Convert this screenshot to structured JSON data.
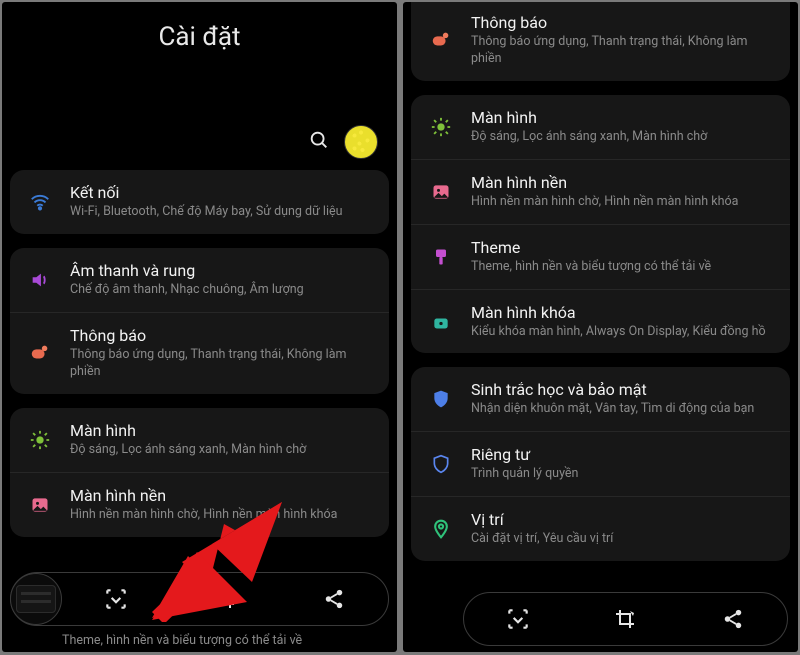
{
  "left": {
    "header_title": "Cài đặt",
    "peek_text": "Theme, hình nền và biểu tượng có thể tải về",
    "sections": [
      {
        "items": [
          {
            "icon": "wifi-icon",
            "color": "c-wifi",
            "title": "Kết nối",
            "sub": "Wi-Fi, Bluetooth, Chế độ Máy bay, Sử dụng dữ liệu"
          }
        ]
      },
      {
        "items": [
          {
            "icon": "sound-icon",
            "color": "c-sound",
            "title": "Âm thanh và rung",
            "sub": "Chế độ âm thanh, Nhạc chuông, Âm lượng"
          },
          {
            "icon": "bell-icon",
            "color": "c-notif",
            "title": "Thông báo",
            "sub": "Thông báo ứng dụng, Thanh trạng thái, Không làm phiền"
          }
        ]
      },
      {
        "items": [
          {
            "icon": "sun-icon",
            "color": "c-disp",
            "title": "Màn hình",
            "sub": "Độ sáng, Lọc ánh sáng xanh, Màn hình chờ"
          },
          {
            "icon": "image-icon",
            "color": "c-wall",
            "title": "Màn hình nền",
            "sub": "Hình nền màn hình chờ, Hình nền màn hình khóa"
          }
        ]
      }
    ]
  },
  "right": {
    "sections": [
      {
        "partial_top": true,
        "items": [
          {
            "icon": "bell-icon",
            "color": "c-notif",
            "title": "Thông báo",
            "sub": "Thông báo ứng dụng, Thanh trạng thái, Không làm phiền"
          }
        ]
      },
      {
        "items": [
          {
            "icon": "sun-icon",
            "color": "c-disp",
            "title": "Màn hình",
            "sub": "Độ sáng, Lọc ánh sáng xanh, Màn hình chờ"
          },
          {
            "icon": "image-icon",
            "color": "c-wall",
            "title": "Màn hình nền",
            "sub": "Hình nền màn hình chờ, Hình nền màn hình khóa"
          },
          {
            "icon": "brush-icon",
            "color": "c-theme",
            "title": "Theme",
            "sub": "Theme, hình nền và biểu tượng có thể tải về"
          },
          {
            "icon": "lock-icon",
            "color": "c-lock",
            "title": "Màn hình khóa",
            "sub": "Kiểu khóa màn hình, Always On Display, Kiểu đồng hồ"
          }
        ]
      },
      {
        "items": [
          {
            "icon": "shield-icon",
            "color": "c-bio",
            "title": "Sinh trắc học và bảo mật",
            "sub": "Nhận diện khuôn mặt, Vân tay, Tìm di động của bạn"
          },
          {
            "icon": "shield-outline-icon",
            "color": "c-priv",
            "title": "Riêng tư",
            "sub": "Trình quản lý quyền"
          },
          {
            "icon": "pin-icon",
            "color": "c-loc",
            "title": "Vị trí",
            "sub": "Cài đặt vị trí, Yêu cầu vị trí"
          }
        ]
      }
    ]
  }
}
